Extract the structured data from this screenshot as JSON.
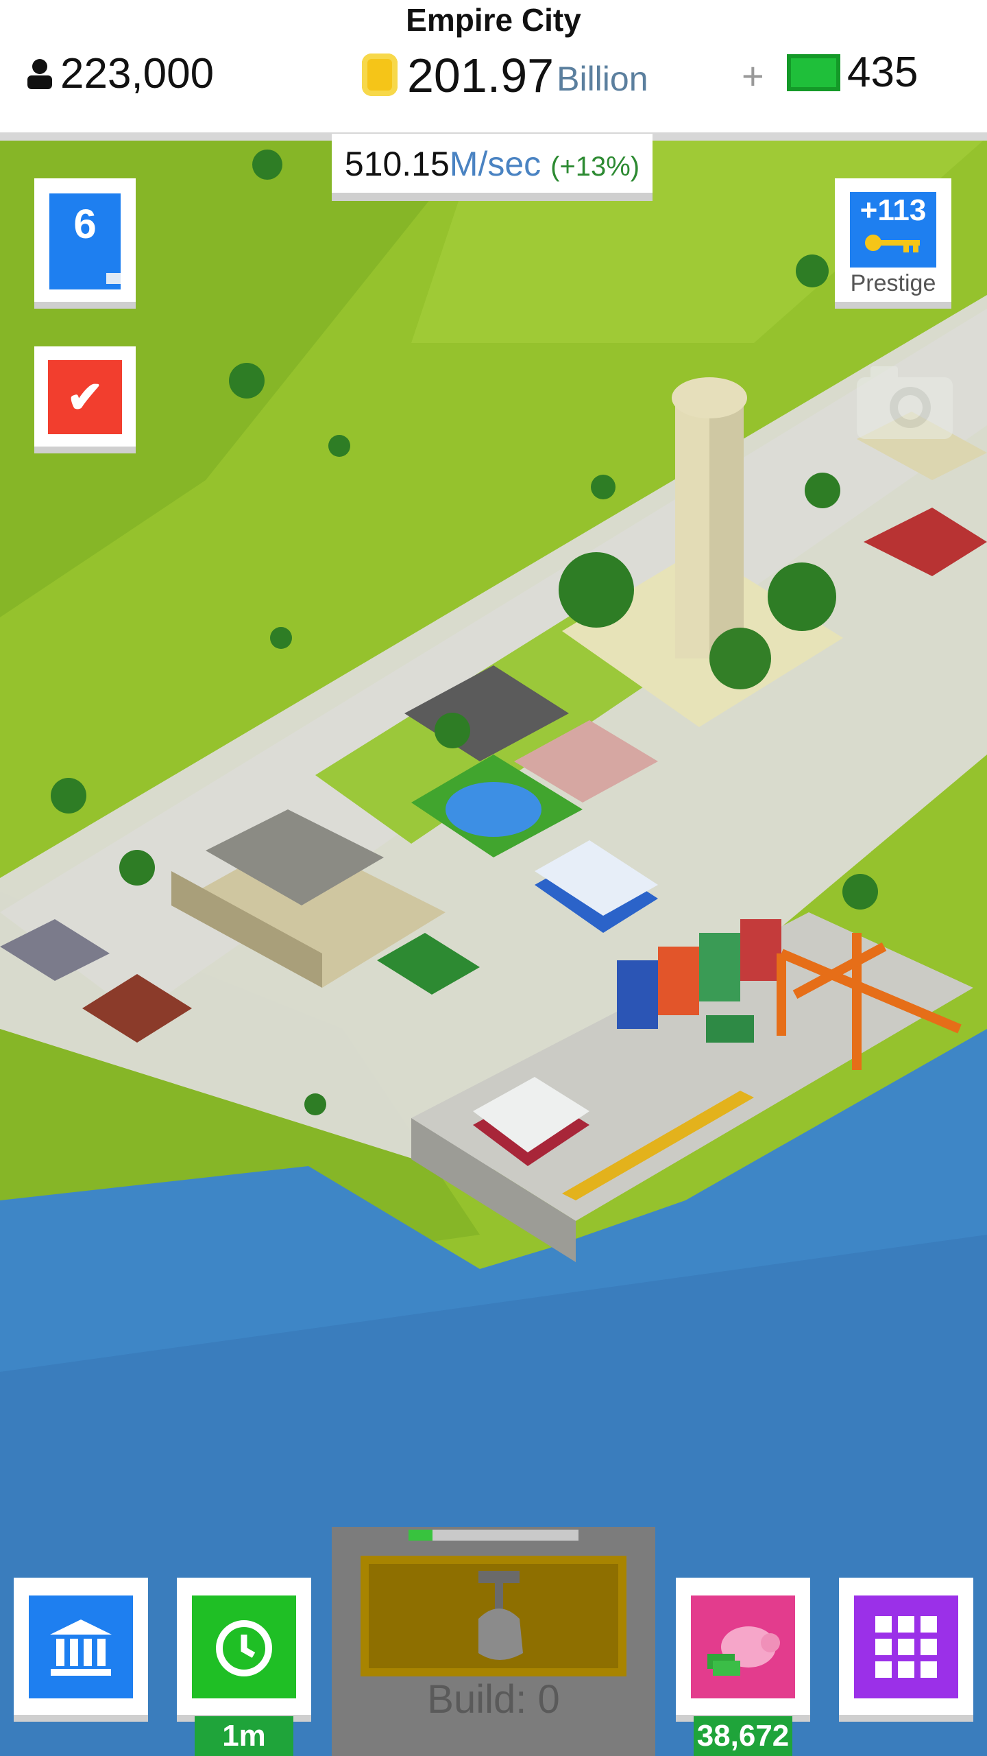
{
  "header": {
    "city_name": "Empire City",
    "population": "223,000",
    "money_value": "201.97",
    "money_unit": "Billion",
    "plus_symbol": "+",
    "cash": "435",
    "income_value": "510.15",
    "income_unit": "M/sec",
    "income_bonus": "(+13%)"
  },
  "side": {
    "level": "6",
    "level_progress_pct": 80,
    "prestige_amount": "+113",
    "prestige_label": "Prestige"
  },
  "bottom": {
    "timer_label": "1m",
    "build_label": "Build: 0",
    "build_progress_pct": 14,
    "piggy_value": "38,672"
  },
  "icons": [
    "person-icon",
    "coin-icon",
    "cash-icon",
    "check-icon",
    "key-icon",
    "camera-icon",
    "bank-icon",
    "clock-icon",
    "hammer-hand-icon",
    "piggy-bank-icon",
    "grid-icon"
  ],
  "colors": {
    "blue": "#1e7ff0",
    "red": "#f23e2e",
    "green": "#1fa43a",
    "purple": "#9b30e8",
    "pink": "#e33c8d",
    "water": "#3a7fc0",
    "grass": "#8fbf2a"
  }
}
